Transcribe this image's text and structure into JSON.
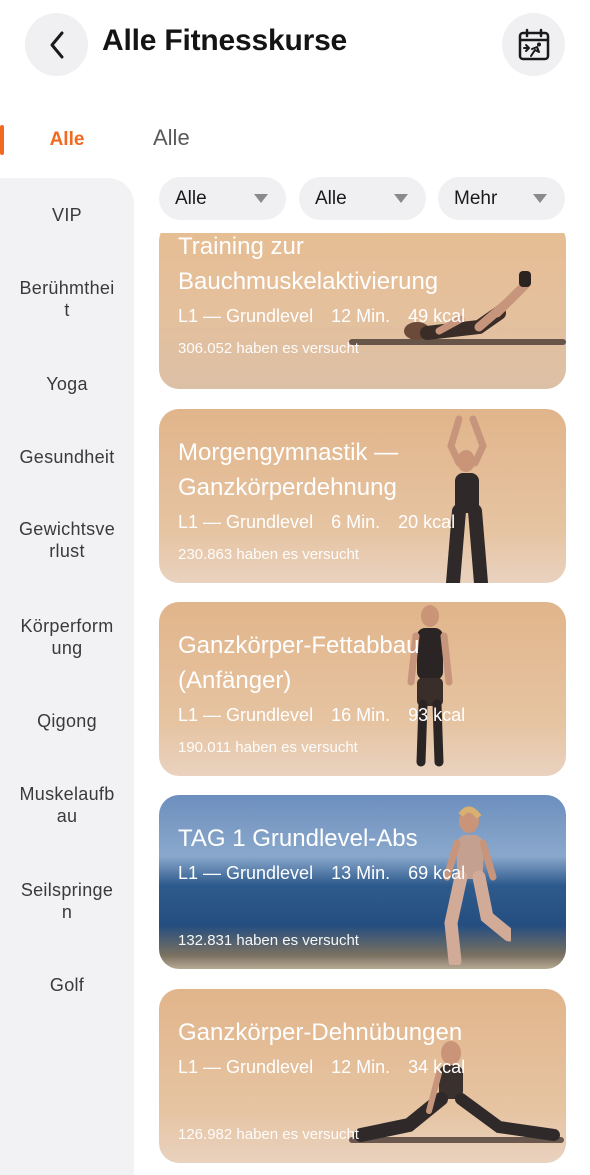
{
  "header": {
    "title": "Alle Fitnesskurse",
    "back_icon": "chevron-left-icon",
    "calendar_icon": "calendar-exercise-icon"
  },
  "sidebar": {
    "active": "Alle",
    "items": [
      {
        "label": "VIP"
      },
      {
        "label": "Berühmthei\nt"
      },
      {
        "label": "Yoga"
      },
      {
        "label": "Gesundheit"
      },
      {
        "label": "Gewichtsve\nrlust"
      },
      {
        "label": "Körperform\nung"
      },
      {
        "label": "Qigong"
      },
      {
        "label": "Muskelaufb\nau"
      },
      {
        "label": "Seilspringe\nn"
      },
      {
        "label": "Golf"
      }
    ]
  },
  "section": {
    "title": "Alle"
  },
  "filters": [
    {
      "label": "Alle"
    },
    {
      "label": "Alle"
    },
    {
      "label": "Mehr"
    }
  ],
  "courses": [
    {
      "title_line1": "Training zur",
      "title_line2": "Bauchmuskelaktivierung",
      "level": "L1 — Grundlevel",
      "duration": "12 Min.",
      "kcal": "49 kcal",
      "participants": "306.052 haben es versucht"
    },
    {
      "title_line1": "Morgengymnastik —",
      "title_line2": "Ganzkörperdehnung",
      "level": "L1 — Grundlevel",
      "duration": "6 Min.",
      "kcal": "20 kcal",
      "participants": "230.863 haben es versucht"
    },
    {
      "title_line1": "Ganzkörper-Fettabbau",
      "title_line2": "(Anfänger)",
      "level": "L1 — Grundlevel",
      "duration": "16 Min.",
      "kcal": "93 kcal",
      "participants": "190.011 haben es versucht"
    },
    {
      "title_line1": "TAG 1 Grundlevel-Abs",
      "title_line2": "",
      "level": "L1 — Grundlevel",
      "duration": "13 Min.",
      "kcal": "69 kcal",
      "participants": "132.831 haben es versucht"
    },
    {
      "title_line1": "Ganzkörper-Dehnübungen",
      "title_line2": "",
      "level": "L1 — Grundlevel",
      "duration": "12 Min.",
      "kcal": "34 kcal",
      "participants": "126.982 haben es versucht"
    }
  ],
  "colors": {
    "accent": "#f26a21",
    "sidebar_bg": "#f2f2f4",
    "chip_bg": "#f0f0f2"
  }
}
